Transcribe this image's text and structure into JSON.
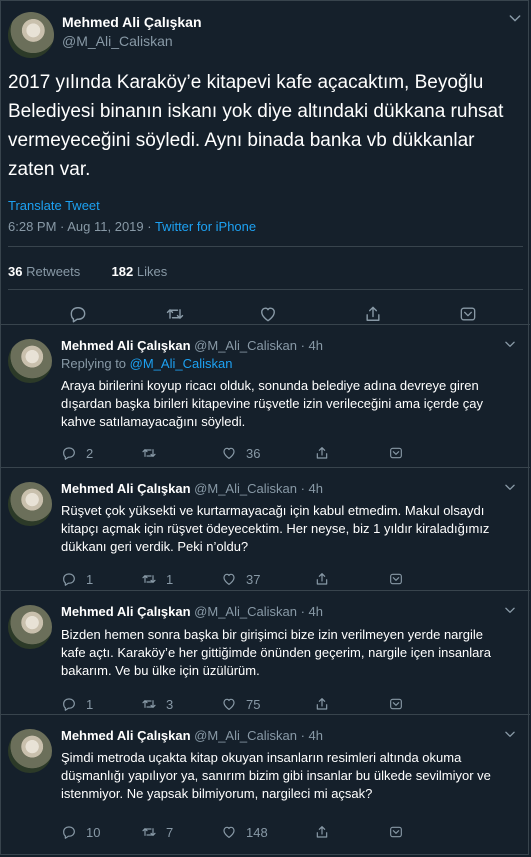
{
  "main_tweet": {
    "name": "Mehmed Ali Çalışkan",
    "handle": "@M_Ali_Caliskan",
    "text": "2017 yılında Karaköy’e kitapevi kafe açacaktım, Beyoğlu Belediyesi binanın iskanı yok diye altındaki dükkana ruhsat vermeyeceğini söyledi. Aynı binada banka vb dükkanlar zaten var.",
    "translate": "Translate Tweet",
    "time": "6:28 PM · Aug 11, 2019 · ",
    "source": "Twitter for iPhone",
    "retweets_count": "36",
    "retweets_label": " Retweets",
    "likes_count": "182",
    "likes_label": " Likes"
  },
  "replies": [
    {
      "name": "Mehmed Ali Çalışkan",
      "handle_time": " @M_Ali_Caliskan · 4h",
      "replying_prefix": "Replying to ",
      "replying_to": "@M_Ali_Caliskan",
      "text": "Araya birilerini koyup ricacı olduk, sonunda belediye adına devreye giren dışardan başka birileri kitapevine rüşvetle izin verileceğini ama içerde çay kahve satılamayacağını söyledi.",
      "replies": "2",
      "retweets": "",
      "likes": "36"
    },
    {
      "name": "Mehmed Ali Çalışkan",
      "handle_time": " @M_Ali_Caliskan · 4h",
      "text": "Rüşvet çok yüksekti ve kurtarmayacağı için kabul etmedim. Makul olsaydı kitapçı açmak için rüşvet ödeyecektim. Her neyse, biz 1 yıldır kiraladığımız dükkanı geri verdik. Peki n’oldu?",
      "replies": "1",
      "retweets": "1",
      "likes": "37"
    },
    {
      "name": "Mehmed Ali Çalışkan",
      "handle_time": " @M_Ali_Caliskan · 4h",
      "text": "Bizden hemen sonra başka bir girişimci bize izin verilmeyen yerde nargile kafe açtı. Karaköy’e her gittiğimde önünden geçerim, nargile içen insanlara bakarım. Ve bu ülke için üzülürüm.",
      "replies": "1",
      "retweets": "3",
      "likes": "75"
    },
    {
      "name": "Mehmed Ali Çalışkan",
      "handle_time": " @M_Ali_Caliskan · 4h",
      "text": "Şimdi metroda uçakta kitap okuyan insanların resimleri altında okuma düşmanlığı yapılıyor ya, sanırım bizim gibi insanlar bu ülkede sevilmiyor ve istenmiyor. Ne yapsak bilmiyorum, nargileci mi açsak?",
      "replies": "10",
      "retweets": "7",
      "likes": "148"
    }
  ],
  "icons": {
    "reply": "reply-icon",
    "retweet": "retweet-icon",
    "like": "heart-icon",
    "share": "share-icon",
    "more": "chevron-down-icon"
  },
  "colors": {
    "background": "#15202b",
    "accent": "#1da1f2",
    "secondary_text": "#8899a6",
    "border": "#38444d"
  }
}
